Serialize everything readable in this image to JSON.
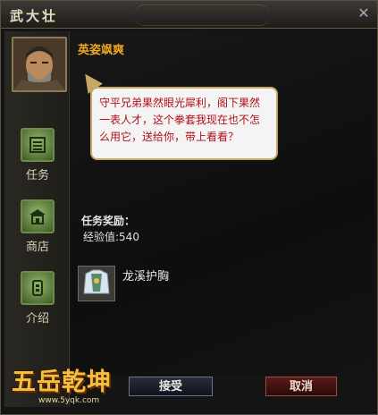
{
  "window": {
    "title": "武大壮"
  },
  "sidebar": {
    "buttons": [
      {
        "label": "任务",
        "icon": "scroll-icon"
      },
      {
        "label": "商店",
        "icon": "shop-icon"
      },
      {
        "label": "介绍",
        "icon": "info-icon"
      }
    ]
  },
  "dialog": {
    "speaker": "英姿飒爽",
    "text": "守平兄弟果然眼光犀利，阁下果然一表人才，这个拳套我现在也不怎么用它，送给你，带上看看？"
  },
  "rewards": {
    "heading": "任务奖励：",
    "exp": "经验值:540",
    "item_name": "龙溪护胸"
  },
  "actions": {
    "accept": "接受",
    "cancel": "取消"
  },
  "branding": {
    "logo": "五岳乾坤",
    "url": "www.5yqk.com"
  },
  "colors": {
    "speaker": "#f0a820",
    "dialog_text": "#b0101a",
    "bubble_bg": "#f4f4f4"
  }
}
